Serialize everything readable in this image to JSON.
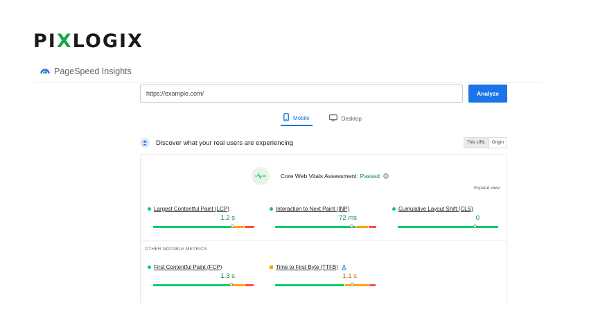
{
  "brand": {
    "prefix": "PI",
    "x": "X",
    "suffix": "LOGIX"
  },
  "psi": {
    "title": "PageSpeed Insights"
  },
  "search": {
    "url": "https://example.com/",
    "analyze_label": "Analyze"
  },
  "tabs": [
    {
      "label": "Mobile",
      "active": true
    },
    {
      "label": "Desktop",
      "active": false
    }
  ],
  "discover": {
    "title": "Discover what your real users are experiencing",
    "this_url": "This URL",
    "origin": "Origin"
  },
  "cwv": {
    "label": "Core Web Vitals Assessment:",
    "status": "Passed",
    "expand": "Expand view"
  },
  "metrics": [
    {
      "name": "Largest Contentful Paint (LCP)",
      "value": "1.2 s",
      "rating": "good",
      "dist": [
        0.78,
        0.12,
        0.1
      ],
      "marker": 0.78
    },
    {
      "name": "Interaction to Next Paint (INP)",
      "value": "72 ms",
      "rating": "good",
      "dist": [
        0.8,
        0.12,
        0.08
      ],
      "marker": 0.75
    },
    {
      "name": "Cumulative Layout Shift (CLS)",
      "value": "0",
      "rating": "good",
      "dist": [
        1.0,
        0,
        0
      ],
      "marker": 0.76
    }
  ],
  "other": {
    "title": "OTHER NOTABLE METRICS",
    "metrics": [
      {
        "name": "First Contentful Paint (FCP)",
        "value": "1.3 s",
        "rating": "good",
        "dist": [
          0.78,
          0.13,
          0.09
        ],
        "marker": 0.77
      },
      {
        "name": "Time to First Byte (TTFB)",
        "value": "1.1 s",
        "rating": "avg",
        "dist": [
          0.69,
          0.24,
          0.07
        ],
        "marker": 0.76
      }
    ]
  },
  "colors": {
    "good": "#0cce6b",
    "average": "#ffa400",
    "poor": "#ff4e42",
    "accent": "#1a73e8"
  }
}
